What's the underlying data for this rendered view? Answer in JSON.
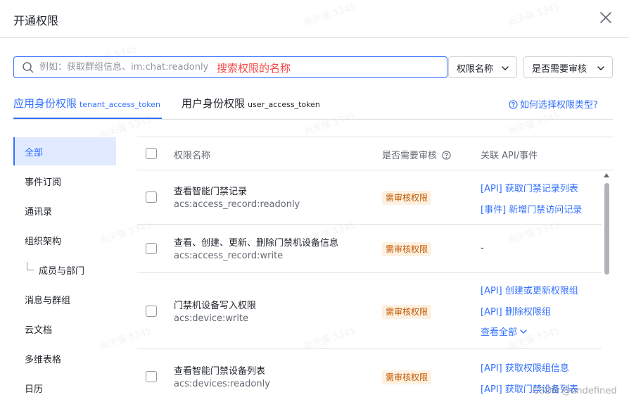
{
  "dialog": {
    "title": "开通权限"
  },
  "search": {
    "placeholder": "例如：获取群组信息、im:chat:readonly",
    "hint": "搜索权限的名称"
  },
  "filters": {
    "name_label": "权限名称",
    "review_label": "是否需要审核"
  },
  "tabs": [
    {
      "label": "应用身份权限",
      "token": "tenant_access_token"
    },
    {
      "label": "用户身份权限",
      "token": "user_access_token"
    }
  ],
  "help_link": "如何选择权限类型?",
  "side_nav": [
    {
      "label": "全部"
    },
    {
      "label": "事件订阅"
    },
    {
      "label": "通讯录"
    },
    {
      "label": "组织架构"
    },
    {
      "label": "成员与部门"
    },
    {
      "label": "消息与群组"
    },
    {
      "label": "云文档"
    },
    {
      "label": "多维表格"
    },
    {
      "label": "日历"
    }
  ],
  "table": {
    "headers": {
      "name": "权限名称",
      "review": "是否需要审核",
      "api": "关联 API/事件"
    },
    "rows": [
      {
        "name": "查看智能门禁记录",
        "code": "acs:access_record:readonly",
        "badge": "需审核权限",
        "apis": [
          "[API] 获取门禁记录列表",
          "[事件] 新增门禁访问记录"
        ]
      },
      {
        "name": "查看、创建、更新、删除门禁机设备信息",
        "code": "acs:access_record:write",
        "badge": "需审核权限",
        "api_none": "-"
      },
      {
        "name": "门禁机设备写入权限",
        "code": "acs:device:write",
        "badge": "需审核权限",
        "apis": [
          "[API] 创建或更新权限组",
          "[API] 删除权限组"
        ],
        "view_all": "查看全部"
      },
      {
        "name": "查看智能门禁设备列表",
        "code": "acs:devices:readonly",
        "badge": "需审核权限",
        "apis": [
          "[API] 获取权限组信息",
          "[API] 获取门禁设备列表"
        ]
      }
    ]
  },
  "watermark": "尚天强 5345",
  "footer_mark": "CSDN @undefined",
  "colors": {
    "accent": "#3370ff",
    "hint_red": "#f54a45",
    "badge_bg": "#fdf1e1",
    "badge_text": "#c25700"
  }
}
